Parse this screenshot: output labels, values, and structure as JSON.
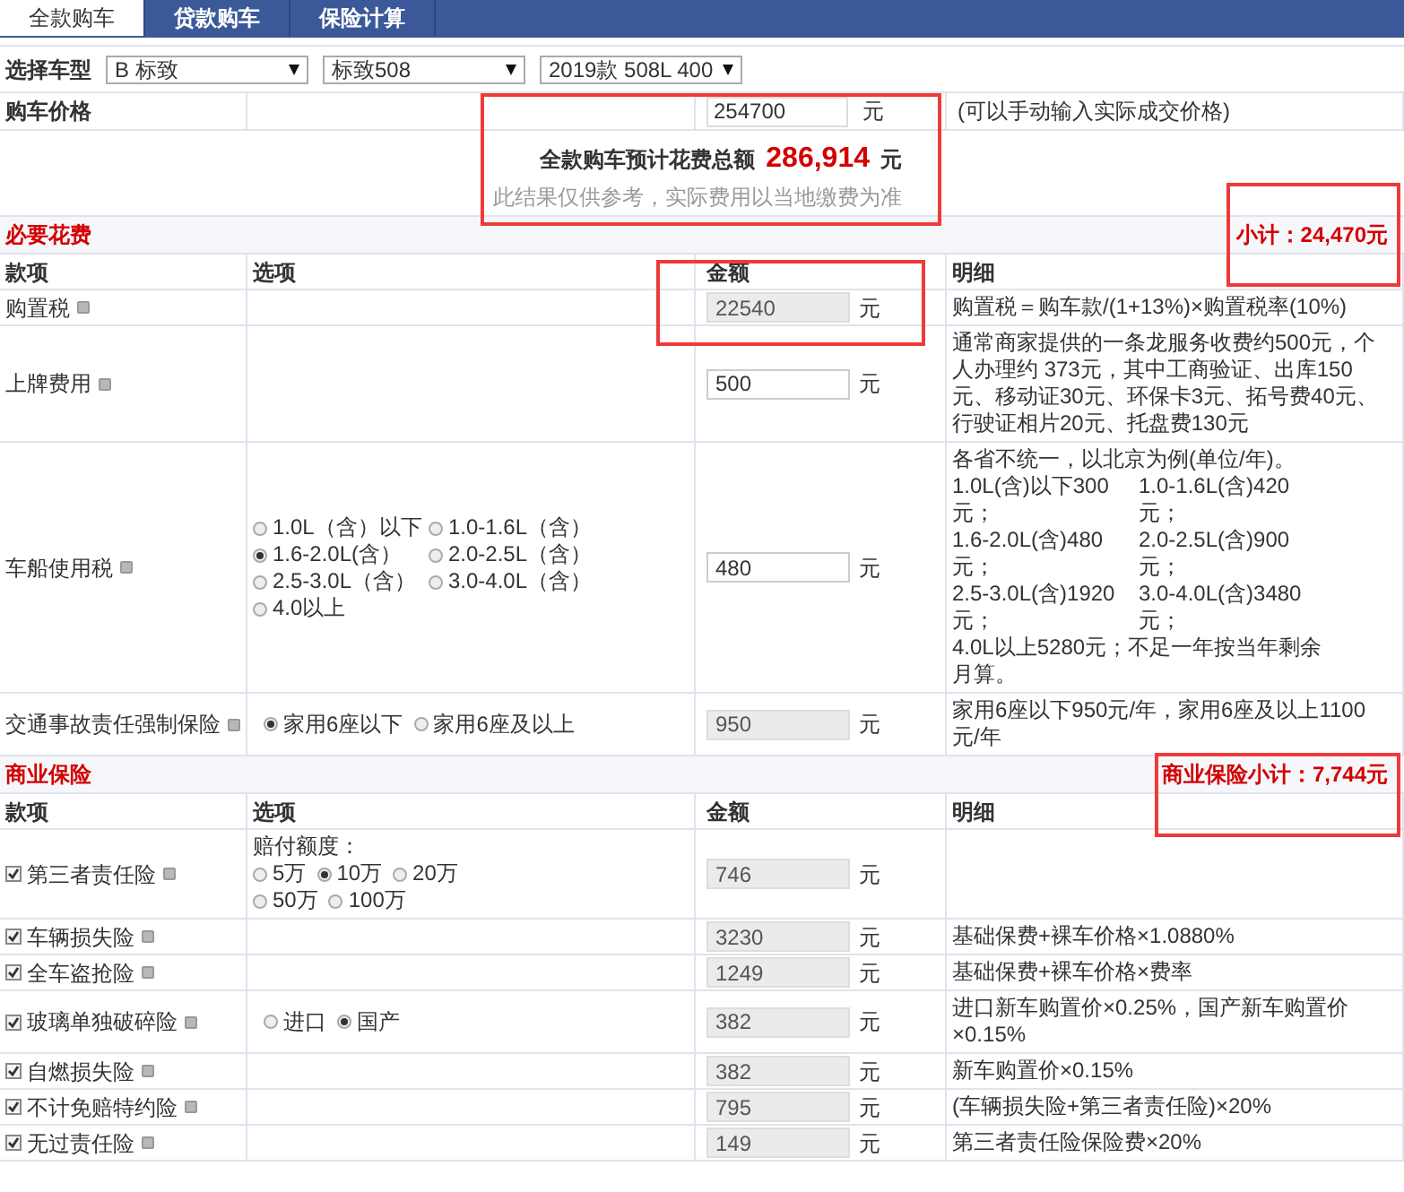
{
  "tabs": [
    {
      "label": "全款购车",
      "selected": true
    },
    {
      "label": "贷款购车",
      "selected": false
    },
    {
      "label": "保险计算",
      "selected": false
    }
  ],
  "car_select": {
    "label": "选择车型",
    "dropdowns": [
      "B 标致",
      "标致508",
      "2019款 508L 400"
    ]
  },
  "price": {
    "label": "购车价格",
    "value": "254700",
    "unit": "元",
    "note": "(可以手动输入实际成交价格)"
  },
  "summary": {
    "label": "全款购车预计花费总额",
    "total": "286,914",
    "unit": "元",
    "disclaimer": "此结果仅供参考，实际费用以当地缴费为准"
  },
  "sections": [
    {
      "title": "必要花费",
      "subtotal": "小计：24,470元",
      "columns": [
        "款项",
        "选项",
        "金额",
        "明细"
      ],
      "rows": [
        {
          "name": "购置税",
          "amount": "22540",
          "disabled": true,
          "unit": "元",
          "detail": "购置税＝购车款/(1+13%)×购置税率(10%)"
        },
        {
          "name": "上牌费用",
          "amount": "500",
          "disabled": false,
          "unit": "元",
          "detail": "通常商家提供的一条龙服务收费约500元，个人办理约 373元，其中工商验证、出库150元、移动证30元、环保卡3元、拓号费40元、行驶证相片20元、托盘费130元"
        },
        {
          "name": "车船使用税",
          "options": {
            "choices": [
              {
                "label": "1.0L（含）以下",
                "selected": false
              },
              {
                "label": "1.0-1.6L（含）",
                "selected": false
              },
              {
                "label": "1.6-2.0L(含）",
                "selected": true
              },
              {
                "label": "2.0-2.5L（含）",
                "selected": false
              },
              {
                "label": "2.5-3.0L（含）",
                "selected": false
              },
              {
                "label": "3.0-4.0L（含）",
                "selected": false
              },
              {
                "label": "4.0以上",
                "selected": false
              }
            ]
          },
          "amount": "480",
          "disabled": false,
          "unit": "元",
          "detail": "各省不统一，以北京为例(单位/年)。",
          "detail_grid": [
            "1.0L(含)以下300元；",
            "1.0-1.6L(含)420元；",
            "1.6-2.0L(含)480元；",
            "2.0-2.5L(含)900元；",
            "2.5-3.0L(含)1920元；",
            "3.0-4.0L(含)3480元；"
          ],
          "detail_after": "4.0L以上5280元；不足一年按当年剩余月算。"
        },
        {
          "name": "交通事故责任强制保险",
          "options": {
            "choices": [
              {
                "label": "家用6座以下",
                "selected": true
              },
              {
                "label": "家用6座及以上",
                "selected": false
              }
            ]
          },
          "amount": "950",
          "disabled": true,
          "unit": "元",
          "detail": "家用6座以下950元/年，家用6座及以上1100元/年"
        }
      ]
    },
    {
      "title": "商业保险",
      "subtotal": "商业保险小计：7,744元",
      "columns": [
        "款项",
        "选项",
        "金额",
        "明细"
      ],
      "rows": [
        {
          "name": "第三者责任险",
          "checked": true,
          "options": {
            "label": "赔付额度：",
            "choices": [
              {
                "label": "5万",
                "selected": false
              },
              {
                "label": "10万",
                "selected": true
              },
              {
                "label": "20万",
                "selected": false
              },
              {
                "label": "50万",
                "selected": false
              },
              {
                "label": "100万",
                "selected": false
              }
            ]
          },
          "amount": "746",
          "disabled": true,
          "unit": "元"
        },
        {
          "name": "车辆损失险",
          "checked": true,
          "amount": "3230",
          "disabled": true,
          "unit": "元",
          "detail": "基础保费+裸车价格×1.0880%"
        },
        {
          "name": "全车盗抢险",
          "checked": true,
          "amount": "1249",
          "disabled": true,
          "unit": "元",
          "detail": "基础保费+裸车价格×费率"
        },
        {
          "name": "玻璃单独破碎险",
          "checked": true,
          "options": {
            "choices": [
              {
                "label": "进口",
                "selected": false
              },
              {
                "label": "国产",
                "selected": true
              }
            ]
          },
          "amount": "382",
          "disabled": true,
          "unit": "元",
          "detail": "进口新车购置价×0.25%，国产新车购置价×0.15%"
        },
        {
          "name": "自燃损失险",
          "checked": true,
          "amount": "382",
          "disabled": true,
          "unit": "元",
          "detail": "新车购置价×0.15%"
        },
        {
          "name": "不计免赔特约险",
          "checked": true,
          "amount": "795",
          "disabled": true,
          "unit": "元",
          "detail": "(车辆损失险+第三者责任险)×20%"
        },
        {
          "name": "无过责任险",
          "checked": true,
          "amount": "149",
          "disabled": true,
          "unit": "元",
          "detail": "第三者责任险保险费×20%"
        }
      ]
    }
  ]
}
